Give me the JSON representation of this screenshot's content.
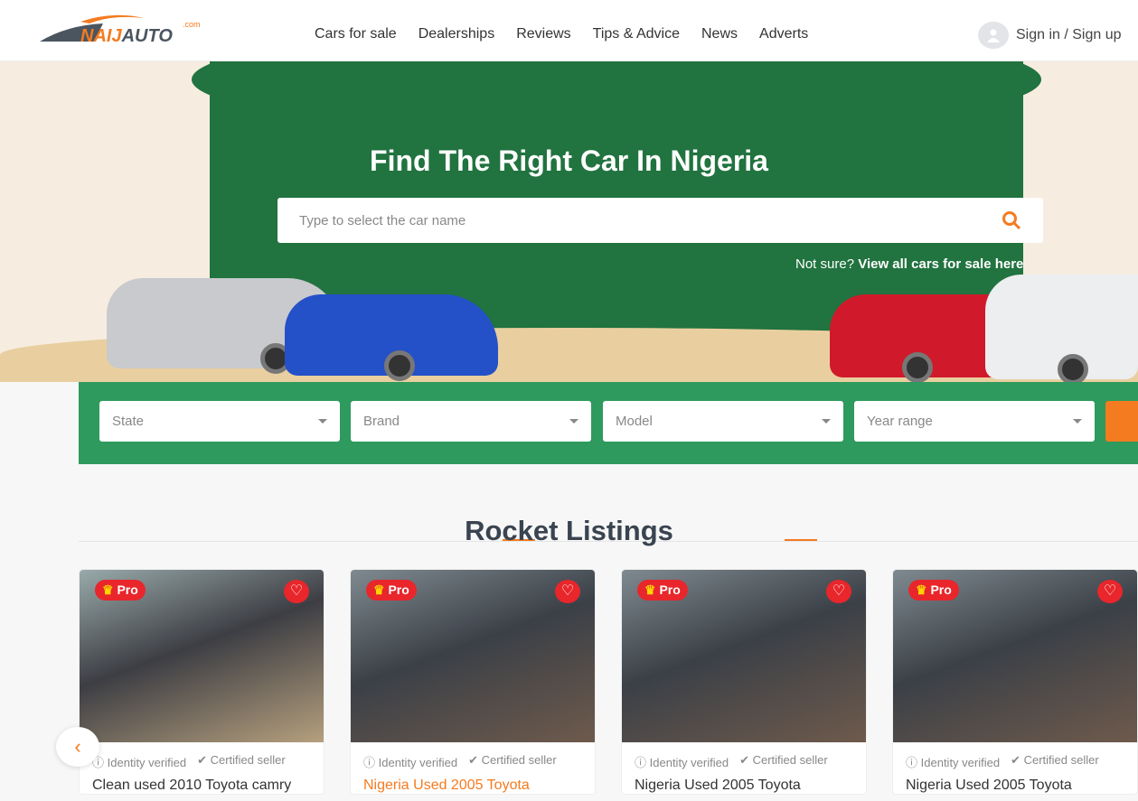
{
  "logo": {
    "text": "NAIJAUTO",
    "suffix": ".com"
  },
  "nav": [
    "Cars for sale",
    "Dealerships",
    "Reviews",
    "Tips & Advice",
    "News",
    "Adverts"
  ],
  "signin": "Sign in / Sign up",
  "hero": {
    "title": "Find The Right Car In Nigeria",
    "search_placeholder": "Type to select the car name",
    "not_sure": "Not sure?",
    "view_all": "View all cars for sale here"
  },
  "filters": [
    "State",
    "Brand",
    "Model",
    "Year range"
  ],
  "section_title": "Rocket Listings",
  "listings": [
    {
      "badge": "Pro",
      "identity": "Identity verified",
      "certified": "Certified seller",
      "title": "Clean used 2010 Toyota camry"
    },
    {
      "badge": "Pro",
      "identity": "Identity verified",
      "certified": "Certified seller",
      "title": "Nigeria Used 2005 Toyota"
    },
    {
      "badge": "Pro",
      "identity": "Identity verified",
      "certified": "Certified seller",
      "title": "Nigeria Used 2005 Toyota"
    },
    {
      "badge": "Pro",
      "identity": "Identity verified",
      "certified": "Certified seller",
      "title": "Nigeria Used 2005 Toyota"
    }
  ],
  "colors": {
    "accent": "#f47b20",
    "green": "#2e9a5d",
    "pro": "#e8262b"
  }
}
